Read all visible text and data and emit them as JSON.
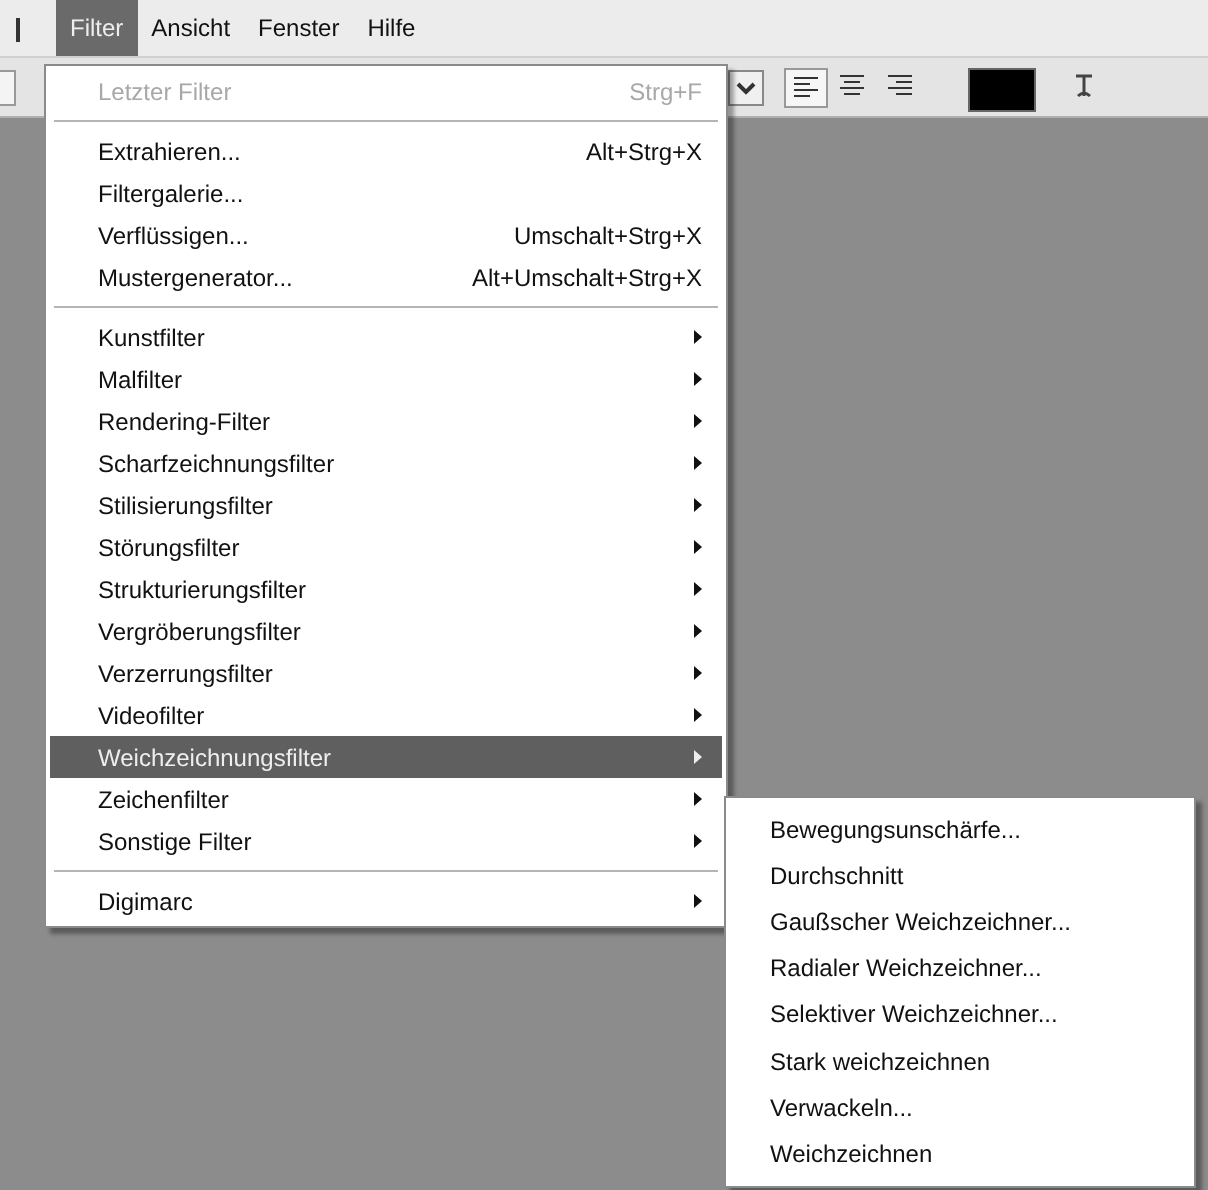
{
  "menubar": [
    {
      "label": "Filter",
      "selected": true
    },
    {
      "label": "Ansicht",
      "selected": false
    },
    {
      "label": "Fenster",
      "selected": false
    },
    {
      "label": "Hilfe",
      "selected": false
    }
  ],
  "filter_menu": {
    "groups": [
      [
        {
          "label": "Letzter Filter",
          "shortcut": "Strg+F",
          "disabled": true,
          "submenu": false,
          "selected": false
        }
      ],
      [
        {
          "label": "Extrahieren...",
          "shortcut": "Alt+Strg+X",
          "disabled": false,
          "submenu": false,
          "selected": false
        },
        {
          "label": "Filtergalerie...",
          "disabled": false,
          "submenu": false,
          "selected": false
        },
        {
          "label": "Verflüssigen...",
          "shortcut": "Umschalt+Strg+X",
          "disabled": false,
          "submenu": false,
          "selected": false
        },
        {
          "label": "Mustergenerator...",
          "shortcut": "Alt+Umschalt+Strg+X",
          "disabled": false,
          "submenu": false,
          "selected": false
        }
      ],
      [
        {
          "label": "Kunstfilter",
          "disabled": false,
          "submenu": true,
          "selected": false
        },
        {
          "label": "Malfilter",
          "disabled": false,
          "submenu": true,
          "selected": false
        },
        {
          "label": "Rendering-Filter",
          "disabled": false,
          "submenu": true,
          "selected": false
        },
        {
          "label": "Scharfzeichnungsfilter",
          "disabled": false,
          "submenu": true,
          "selected": false
        },
        {
          "label": "Stilisierungsfilter",
          "disabled": false,
          "submenu": true,
          "selected": false
        },
        {
          "label": "Störungsfilter",
          "disabled": false,
          "submenu": true,
          "selected": false
        },
        {
          "label": "Strukturierungsfilter",
          "disabled": false,
          "submenu": true,
          "selected": false
        },
        {
          "label": "Vergröberungsfilter",
          "disabled": false,
          "submenu": true,
          "selected": false
        },
        {
          "label": "Verzerrungsfilter",
          "disabled": false,
          "submenu": true,
          "selected": false
        },
        {
          "label": "Videofilter",
          "disabled": false,
          "submenu": true,
          "selected": false
        },
        {
          "label": "Weichzeichnungsfilter",
          "disabled": false,
          "submenu": true,
          "selected": true
        },
        {
          "label": "Zeichenfilter",
          "disabled": false,
          "submenu": true,
          "selected": false
        },
        {
          "label": "Sonstige Filter",
          "disabled": false,
          "submenu": true,
          "selected": false
        }
      ],
      [
        {
          "label": "Digimarc",
          "disabled": false,
          "submenu": true,
          "selected": false
        }
      ]
    ]
  },
  "blur_submenu": {
    "items": [
      {
        "label": "Bewegungsunschärfe..."
      },
      {
        "label": "Durchschnitt"
      },
      {
        "label": "Gaußscher Weichzeichner..."
      },
      {
        "label": "Radialer Weichzeichner..."
      },
      {
        "label": "Selektiver Weichzeichner..."
      },
      {
        "label": "Stark weichzeichnen"
      },
      {
        "label": "Verwackeln..."
      },
      {
        "label": "Weichzeichnen"
      }
    ]
  }
}
